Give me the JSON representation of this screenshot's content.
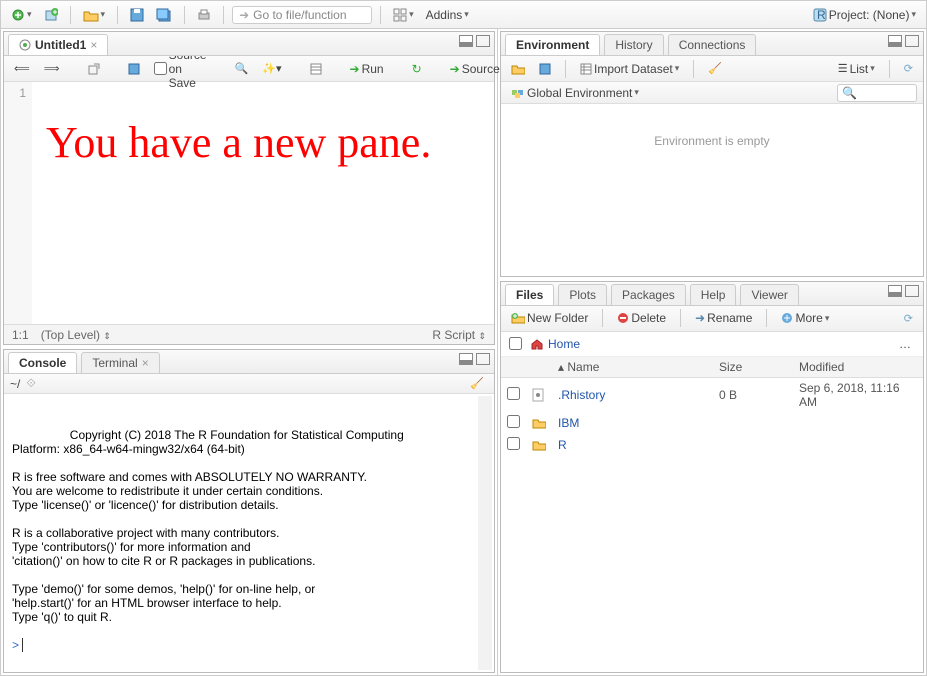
{
  "toolbar": {
    "goto_placeholder": "Go to file/function",
    "addins_label": "Addins",
    "project_label": "Project: (None)"
  },
  "source_pane": {
    "tab_title": "Untitled1",
    "source_on_save": "Source on Save",
    "run_label": "Run",
    "source_label": "Source",
    "line_number": "1",
    "annotation_text": "You have a new pane.",
    "status_pos": "1:1",
    "status_scope": "(Top Level)",
    "status_type": "R Script"
  },
  "console_pane": {
    "tabs": [
      "Console",
      "Terminal"
    ],
    "path": "~/",
    "output": "Copyright (C) 2018 The R Foundation for Statistical Computing\nPlatform: x86_64-w64-mingw32/x64 (64-bit)\n\nR is free software and comes with ABSOLUTELY NO WARRANTY.\nYou are welcome to redistribute it under certain conditions.\nType 'license()' or 'licence()' for distribution details.\n\nR is a collaborative project with many contributors.\nType 'contributors()' for more information and\n'citation()' on how to cite R or R packages in publications.\n\nType 'demo()' for some demos, 'help()' for on-line help, or\n'help.start()' for an HTML browser interface to help.\nType 'q()' to quit R.\n",
    "prompt": "> "
  },
  "env_pane": {
    "tabs": [
      "Environment",
      "History",
      "Connections"
    ],
    "import_label": "Import Dataset",
    "list_label": "List",
    "scope_label": "Global Environment",
    "empty_msg": "Environment is empty"
  },
  "files_pane": {
    "tabs": [
      "Files",
      "Plots",
      "Packages",
      "Help",
      "Viewer"
    ],
    "new_folder": "New Folder",
    "delete": "Delete",
    "rename": "Rename",
    "more": "More",
    "home_label": "Home",
    "columns": {
      "name": "Name",
      "size": "Size",
      "modified": "Modified"
    },
    "rows": [
      {
        "name": ".Rhistory",
        "size": "0 B",
        "modified": "Sep 6, 2018, 11:16 AM",
        "icon": "file"
      },
      {
        "name": "IBM",
        "size": "",
        "modified": "",
        "icon": "folder"
      },
      {
        "name": "R",
        "size": "",
        "modified": "",
        "icon": "folder"
      }
    ]
  }
}
